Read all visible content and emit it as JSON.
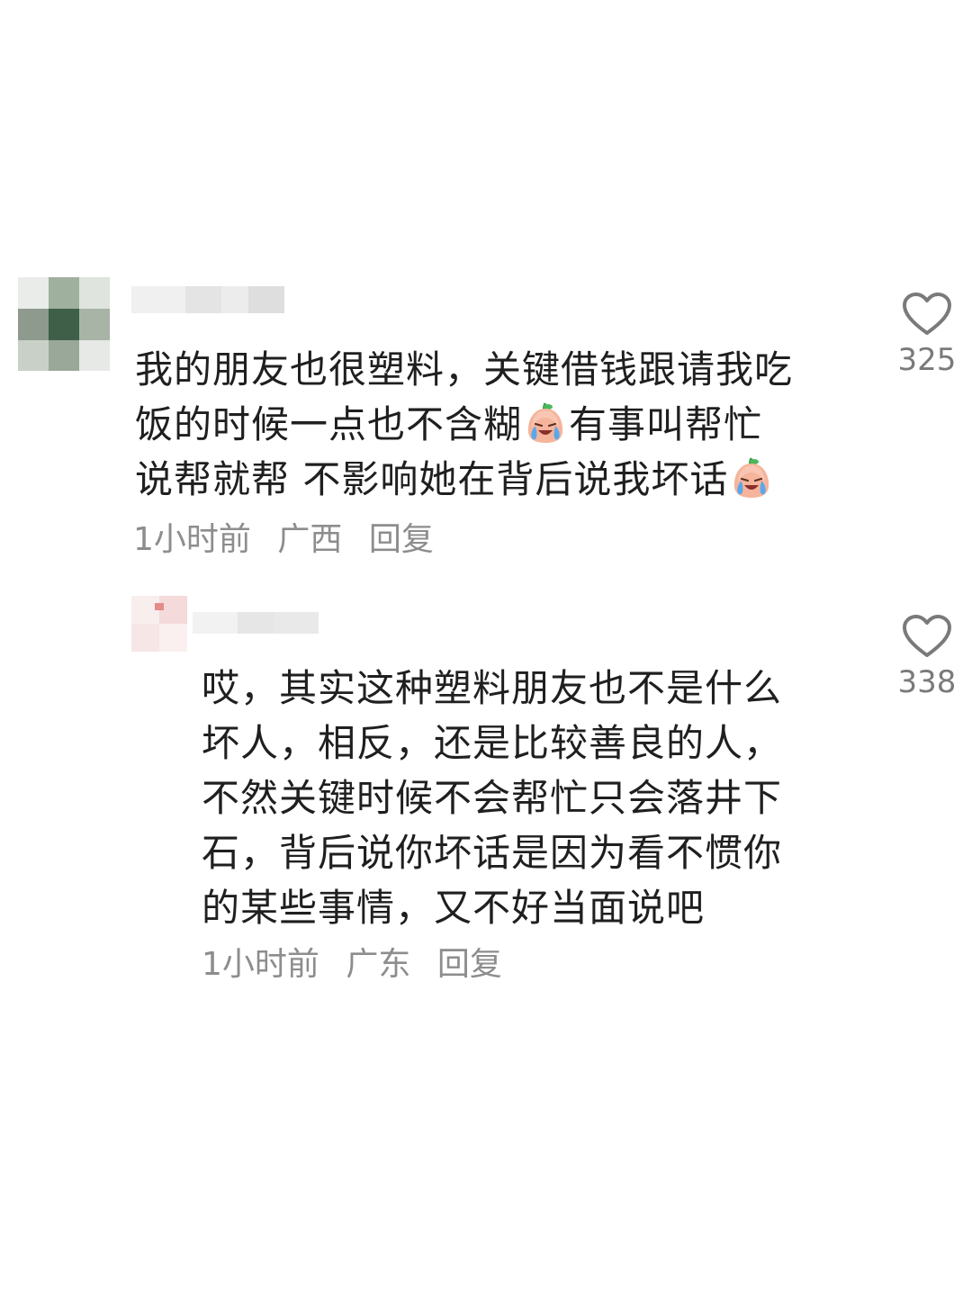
{
  "comments": [
    {
      "text_lines": [
        "我的朋友也很塑料，关键借钱跟请我吃",
        "饭的时候一点也不含糊",
        "有事叫帮忙",
        "说帮就帮 不影响她在背后说我坏话"
      ],
      "meta": {
        "time": "1小时前",
        "location": "广西",
        "reply": "回复"
      },
      "likes": "325",
      "emoji_icon": "crying-face-emoji"
    },
    {
      "text_lines": [
        "哎，其实这种塑料朋友也不是什么",
        "坏人，相反，还是比较善良的人，",
        "不然关键时候不会帮忙只会落井下",
        "石，背后说你坏话是因为看不惯你",
        "的某些事情，又不好当面说吧"
      ],
      "meta": {
        "time": "1小时前",
        "location": "广东",
        "reply": "回复"
      },
      "likes": "338"
    }
  ],
  "colors": {
    "text": "#1f1f1f",
    "meta": "#8d8d8d",
    "like_icon": "#7a7a7a"
  }
}
